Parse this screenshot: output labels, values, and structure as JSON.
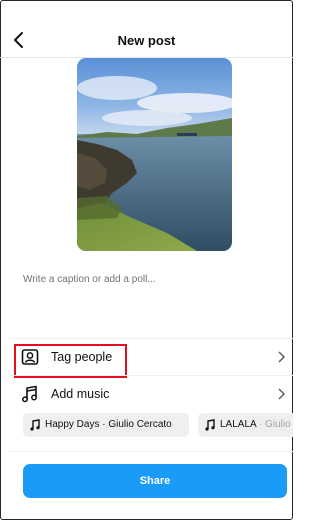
{
  "header": {
    "title": "New post"
  },
  "caption": {
    "placeholder": "Write a caption or add a poll..."
  },
  "rows": {
    "tag_people": "Tag people",
    "add_music": "Add music"
  },
  "music_suggestions": [
    {
      "title": "Happy Days",
      "separator": " · ",
      "artist": "Giulio Cercato"
    },
    {
      "title": "LALALA",
      "separator": " · ",
      "artist": "Giulio"
    }
  ],
  "share_button": "Share",
  "colors": {
    "accent": "#1a9bf7",
    "highlight": "#e0101e"
  },
  "icons": {
    "back": "chevron-left-icon",
    "tag": "person-tag-icon",
    "music": "music-note-icon",
    "chevron": "chevron-right-icon"
  }
}
